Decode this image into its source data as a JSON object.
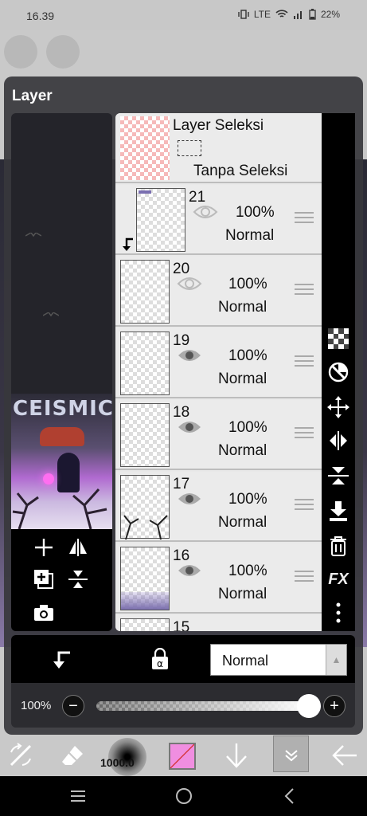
{
  "status": {
    "time": "16.39",
    "battery": "22%",
    "network": "LTE"
  },
  "panel": {
    "title": "Layer"
  },
  "artwork": {
    "title": "CEISMIC"
  },
  "selection_layer": {
    "title": "Layer Seleksi",
    "subtitle": "Tanpa Seleksi"
  },
  "layers": [
    {
      "number": "21",
      "opacity": "100%",
      "blend": "Normal",
      "visible": true,
      "clipped": true
    },
    {
      "number": "20",
      "opacity": "100%",
      "blend": "Normal",
      "visible": true,
      "clipped": false
    },
    {
      "number": "19",
      "opacity": "100%",
      "blend": "Normal",
      "visible": true,
      "clipped": false
    },
    {
      "number": "18",
      "opacity": "100%",
      "blend": "Normal",
      "visible": true,
      "clipped": false
    },
    {
      "number": "17",
      "opacity": "100%",
      "blend": "Normal",
      "visible": true,
      "clipped": false
    },
    {
      "number": "16",
      "opacity": "100%",
      "blend": "Normal",
      "visible": true,
      "clipped": false
    },
    {
      "number": "15",
      "opacity": "",
      "blend": "",
      "visible": true,
      "clipped": false
    }
  ],
  "right_toolbar": {
    "fx_label": "FX"
  },
  "blend_mode": {
    "selected": "Normal"
  },
  "opacity": {
    "label": "100%",
    "value": 1.0
  },
  "bottom_toolbar": {
    "brush_size": "1000.0",
    "color": "#f08ee0"
  },
  "icons": [
    "add-layer-icon",
    "flip-horizontal-icon",
    "duplicate-icon",
    "merge-icon",
    "camera-icon",
    "checker-icon",
    "invert-icon",
    "move-icon",
    "flip-icon",
    "flip-vertical-icon",
    "download-icon",
    "trash-icon",
    "more-icon",
    "clip-icon",
    "lock-alpha-icon",
    "transform-icon",
    "eraser-icon",
    "arrow-down-icon",
    "chevron-down-icon",
    "back-arrow-icon"
  ]
}
